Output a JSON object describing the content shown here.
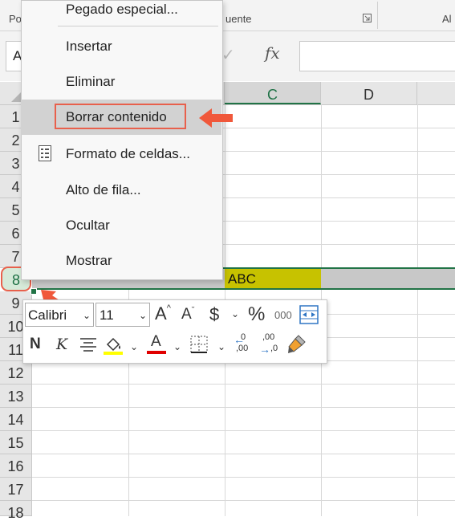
{
  "ribbon": {
    "left_label": "Po",
    "middle_label": "uente",
    "right_label": "Al"
  },
  "formula_bar": {
    "namebox_value": "A",
    "fx_label": "fx"
  },
  "grid": {
    "columns": [
      "C",
      "D"
    ],
    "rows": [
      "1",
      "2",
      "3",
      "4",
      "5",
      "6",
      "7",
      "8",
      "9",
      "10",
      "11",
      "12",
      "13",
      "14",
      "15",
      "16",
      "17",
      "18"
    ],
    "cell_c8": "ABC"
  },
  "context_menu": {
    "items": [
      {
        "label": "Pegado especial..."
      },
      {
        "label": "Insertar"
      },
      {
        "label": "Eliminar"
      },
      {
        "label": "Borrar contenido"
      },
      {
        "label": "Formato de celdas..."
      },
      {
        "label": "Alto de fila..."
      },
      {
        "label": "Ocultar"
      },
      {
        "label": "Mostrar"
      }
    ]
  },
  "mini_toolbar": {
    "font_name": "Calibri",
    "font_size": "11",
    "currency_symbol": "$",
    "percent_symbol": "%",
    "thousands_label": "000",
    "bold_label": "N",
    "italic_label": "K",
    "grow_font_label": "A",
    "shrink_font_label": "A",
    "font_color_label": "A",
    "increase_decimals_label": ",00",
    "decrease_decimals_label": ",0"
  },
  "colors": {
    "excel_green": "#217346",
    "highlight": "#e8604c",
    "cell_fill": "#c7c200",
    "fill_color_bar": "#ffff00",
    "font_color_bar": "#e00000"
  }
}
